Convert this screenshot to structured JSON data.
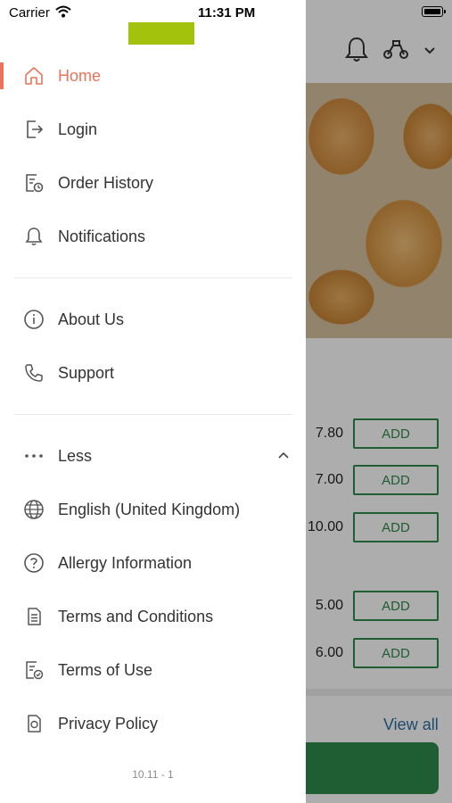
{
  "status_bar": {
    "carrier": "Carrier",
    "time": "11:31 PM"
  },
  "menu": {
    "items": [
      {
        "label": "Home",
        "icon": "home-icon",
        "active": true
      },
      {
        "label": "Login",
        "icon": "login-icon"
      },
      {
        "label": "Order History",
        "icon": "order-history-icon"
      },
      {
        "label": "Notifications",
        "icon": "bell-icon"
      },
      {
        "label": "About Us",
        "icon": "info-icon"
      },
      {
        "label": "Support",
        "icon": "phone-icon"
      },
      {
        "label": "Less",
        "icon": "more-dots-icon"
      },
      {
        "label": "English (United Kingdom)",
        "icon": "globe-icon"
      },
      {
        "label": "Allergy Information",
        "icon": "question-icon"
      },
      {
        "label": "Terms and Conditions",
        "icon": "document-icon"
      },
      {
        "label": "Terms of Use",
        "icon": "document-check-icon"
      },
      {
        "label": "Privacy Policy",
        "icon": "privacy-icon"
      }
    ],
    "version": "10.11 - 1"
  },
  "background": {
    "prices": [
      "7.80",
      "7.00",
      "10.00",
      "5.00",
      "6.00"
    ],
    "add_label": "ADD",
    "view_all": "View all"
  },
  "colors": {
    "accent": "#e8745b",
    "brand_green": "#2f8a4b",
    "logo_green": "#a3c20c"
  }
}
